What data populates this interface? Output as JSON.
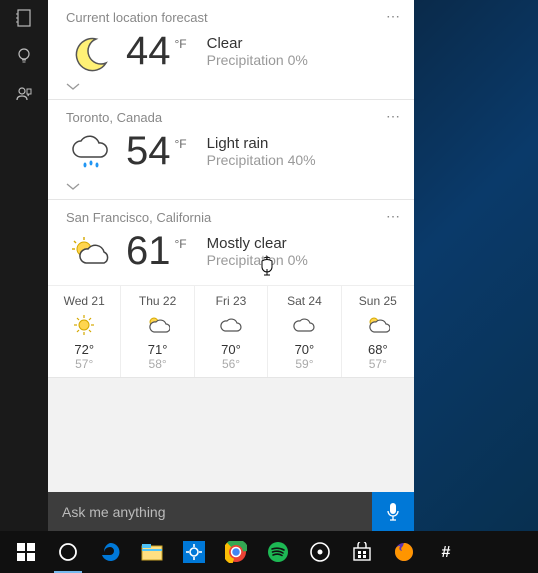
{
  "sidebar": {
    "items": [
      "notebook",
      "lightbulb",
      "feedback"
    ]
  },
  "cards": [
    {
      "header": "Current location forecast",
      "icon": "moon",
      "temp": "44",
      "unit": "°F",
      "condition": "Clear",
      "precip": "Precipitation 0%"
    },
    {
      "header": "Toronto, Canada",
      "icon": "rain",
      "temp": "54",
      "unit": "°F",
      "condition": "Light rain",
      "precip": "Precipitation 40%"
    },
    {
      "header": "San Francisco, California",
      "icon": "partly-sunny",
      "temp": "61",
      "unit": "°F",
      "condition": "Mostly clear",
      "precip": "Precipitation 0%",
      "forecast": [
        {
          "label": "Wed 21",
          "icon": "sunny",
          "hi": "72°",
          "lo": "57°"
        },
        {
          "label": "Thu 22",
          "icon": "partly-sunny",
          "hi": "71°",
          "lo": "58°"
        },
        {
          "label": "Fri 23",
          "icon": "cloudy",
          "hi": "70°",
          "lo": "56°"
        },
        {
          "label": "Sat 24",
          "icon": "cloudy",
          "hi": "70°",
          "lo": "59°"
        },
        {
          "label": "Sun 25",
          "icon": "partly-sunny",
          "hi": "68°",
          "lo": "57°"
        }
      ]
    }
  ],
  "search": {
    "placeholder": "Ask me anything"
  },
  "taskbar": {
    "items": [
      {
        "id": "start",
        "color": "#fff"
      },
      {
        "id": "cortana",
        "color": "#fff",
        "active": true
      },
      {
        "id": "edge",
        "color": "#0078d7"
      },
      {
        "id": "file-explorer",
        "color": "#ffcf48"
      },
      {
        "id": "settings",
        "color": "#0078d7"
      },
      {
        "id": "chrome",
        "color": "#ea4335"
      },
      {
        "id": "spotify",
        "color": "#1db954"
      },
      {
        "id": "disc",
        "color": "#fff"
      },
      {
        "id": "store",
        "color": "#fff"
      },
      {
        "id": "firefox",
        "color": "#ff9500"
      },
      {
        "id": "slack",
        "color": "#fff"
      }
    ]
  },
  "more_glyph": "⋯"
}
